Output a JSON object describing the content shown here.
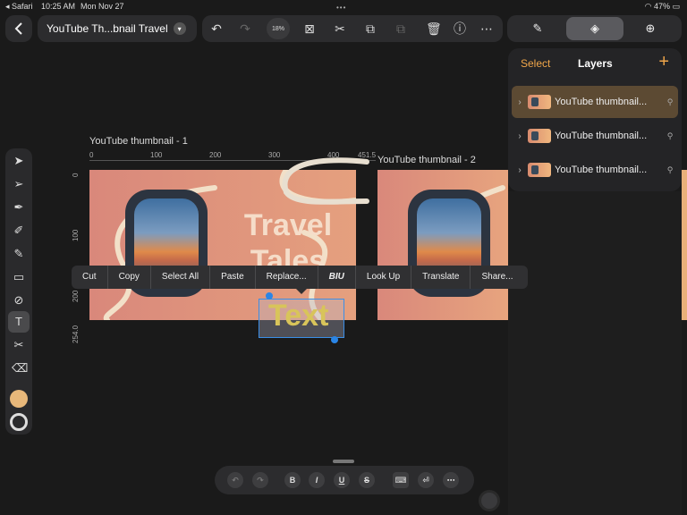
{
  "status_bar": {
    "app": "◂ Safari",
    "time": "10:25 AM",
    "date": "Mon Nov 27",
    "battery": "47%"
  },
  "toolbar": {
    "document_title": "YouTube Th...bnail Travel",
    "zoom_level": "18%"
  },
  "right_tabs": [
    {
      "name": "brush-tab"
    },
    {
      "name": "layers-tab",
      "active": true
    },
    {
      "name": "add-tab"
    }
  ],
  "layers_panel": {
    "select_label": "Select",
    "title": "Layers",
    "layers": [
      {
        "label": "YouTube thumbnail...",
        "active": true
      },
      {
        "label": "YouTube thumbnail...",
        "active": false
      },
      {
        "label": "YouTube thumbnail...",
        "active": false
      }
    ]
  },
  "canvas": {
    "artboard1_label": "YouTube thumbnail - 1",
    "artboard2_label": "YouTube thumbnail - 2",
    "ruler_h": [
      "0",
      "100",
      "200",
      "300",
      "400",
      "451.5"
    ],
    "ruler_v": [
      "0",
      "100",
      "200",
      "254.0"
    ],
    "art_title_line1": "Travel",
    "art_title_line2": "Tales",
    "selected_text": "Text"
  },
  "context_menu": {
    "items": [
      "Cut",
      "Copy",
      "Select All",
      "Paste",
      "Replace...",
      "BIU",
      "Look Up",
      "Translate",
      "Share..."
    ]
  },
  "text_toolbar": {
    "bold": "B",
    "italic": "I",
    "underline": "U",
    "strike": "S"
  },
  "colors": {
    "fill": "#e8b87a",
    "accent": "#f0a64a",
    "selection": "#2a85e6"
  }
}
